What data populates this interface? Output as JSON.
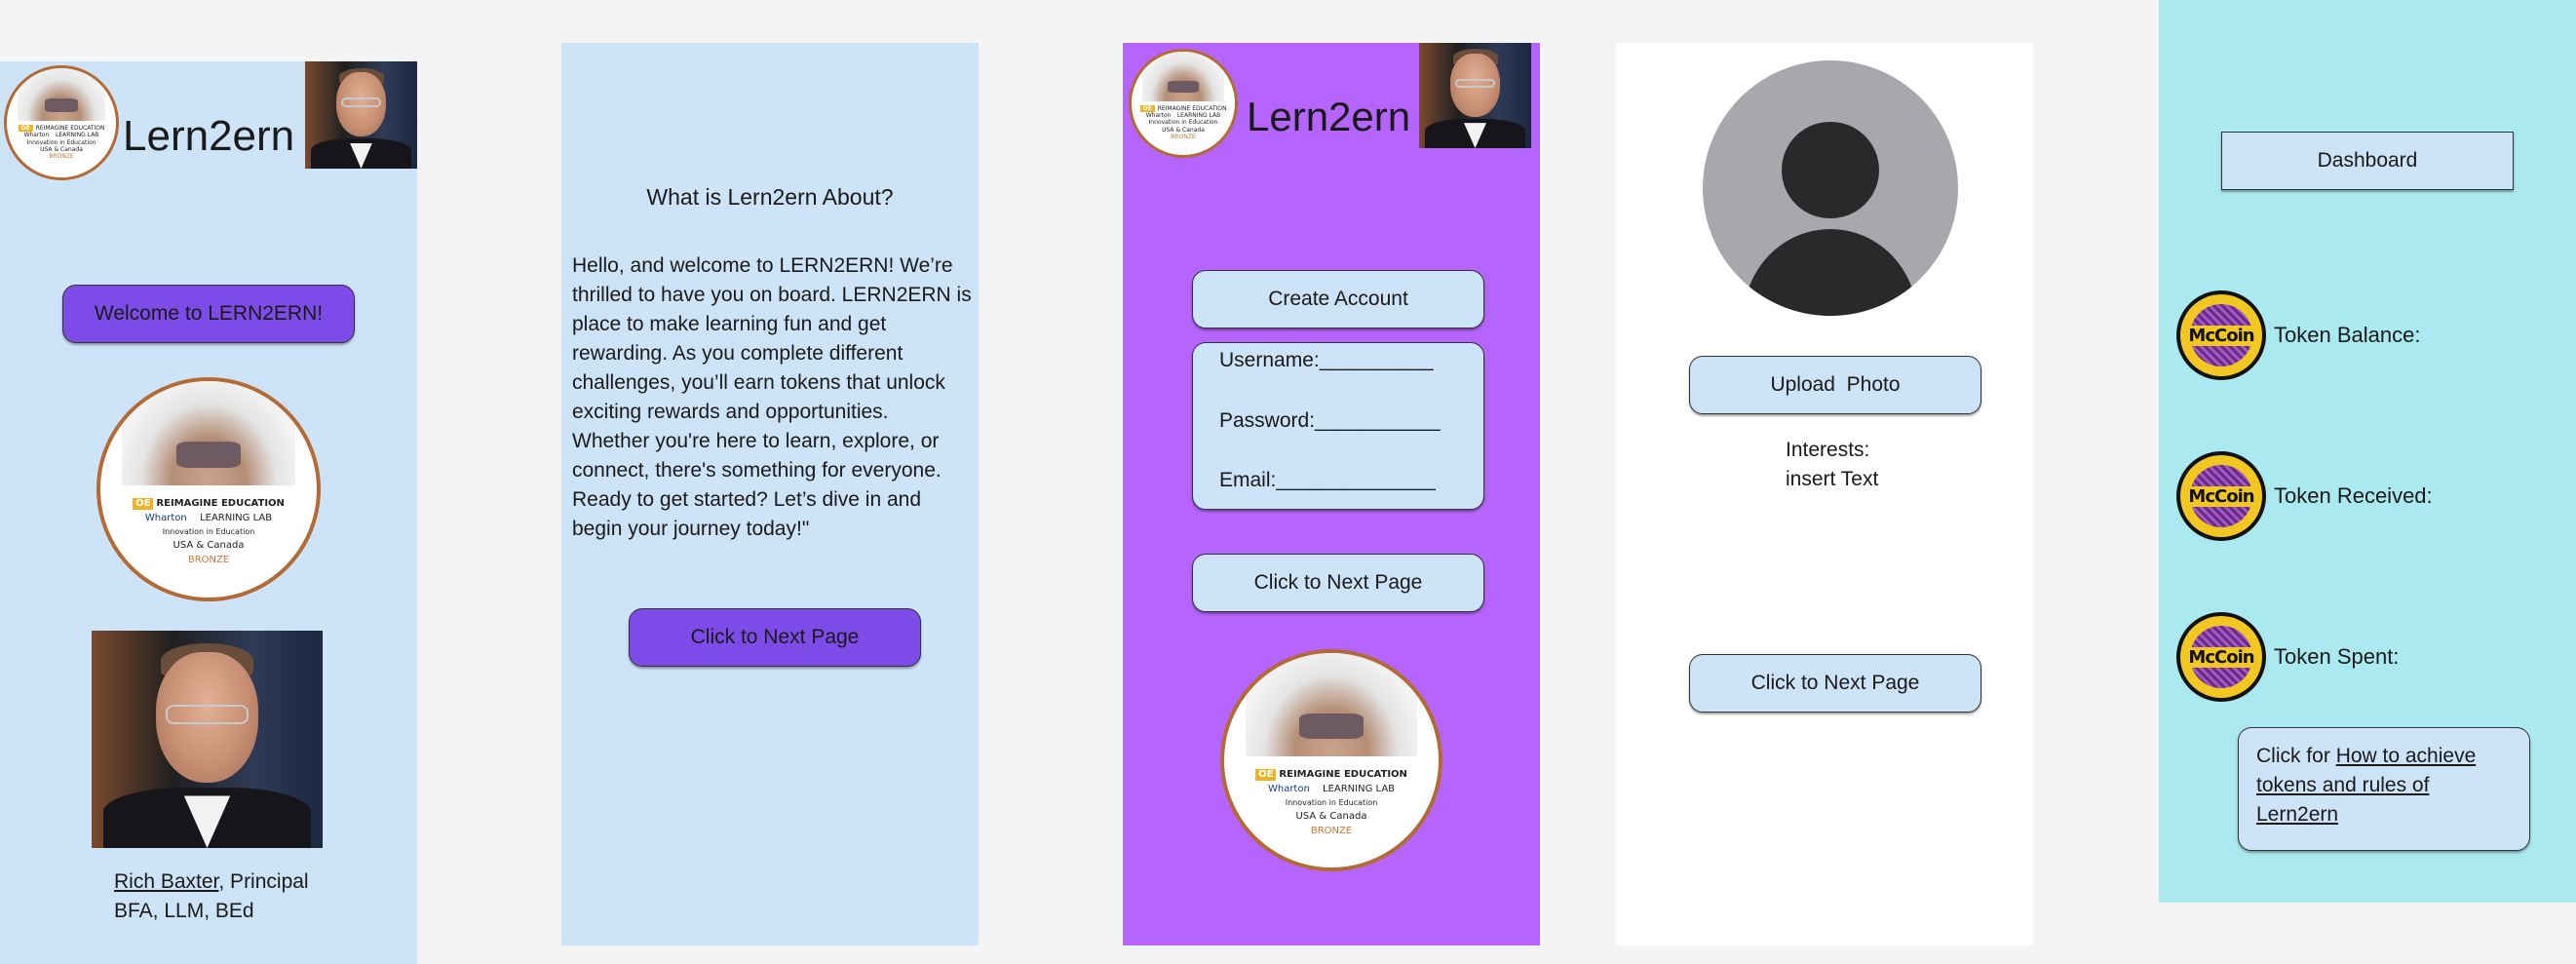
{
  "app": {
    "name": "Lern2ern"
  },
  "badge": {
    "oe": "OE",
    "title": "REIMAGINE EDUCATION",
    "partner_left": "Wharton",
    "partner_right": "LEARNING LAB",
    "category": "Innovation in Education",
    "region": "USA & Canada",
    "level": "BRONZE"
  },
  "frame1": {
    "brand": "Lern2ern",
    "welcome_button": "Welcome to LERN2ERN!",
    "person_name": "Rich Baxter",
    "person_role": ", Principal",
    "person_degrees": "BFA, LLM, BEd"
  },
  "frame2": {
    "heading": "What is Lern2ern About?",
    "body_lines": [
      "Hello, and welcome to LERN2ERN! We’re",
      "thrilled to have you on board. LERN2ERN is",
      "place to make learning fun and get",
      "rewarding. As you complete different",
      "challenges, you’ll earn tokens that unlock",
      "exciting rewards and opportunities.",
      "Whether you're here to learn, explore, or",
      "connect, there's something for everyone.",
      "Ready to get started? Let’s dive in and",
      "begin your journey today!\""
    ],
    "next_button": "Click to Next Page"
  },
  "frame3": {
    "brand": "Lern2ern",
    "create_account_button": "Create Account",
    "username_label": "Username:__________",
    "password_label": "Password:___________",
    "email_label": "Email:______________",
    "next_button": "Click to Next Page"
  },
  "frame4": {
    "upload_button": "Upload  Photo",
    "interests_label": "Interests:",
    "interests_placeholder": "insert Text",
    "next_button": "Click to Next Page"
  },
  "frame5": {
    "dashboard_button": "Dashboard",
    "coin_text": "McCoin",
    "token_balance_label": "Token Balance:",
    "token_received_label": "Token Received:",
    "token_spent_label": "Token Spent:",
    "help_prefix": "Click for ",
    "help_link_line1": "How to achieve",
    "help_link_line2": "tokens and rules of",
    "help_link_line3": "Lern2ern"
  },
  "colors": {
    "light_blue": "#cde3f8",
    "purple_frame": "#b565fd",
    "purple_button": "#7d4be7",
    "cyan_frame": "#aae9ef",
    "badge_border": "#b36a35",
    "coin_gold": "#f3c722"
  }
}
